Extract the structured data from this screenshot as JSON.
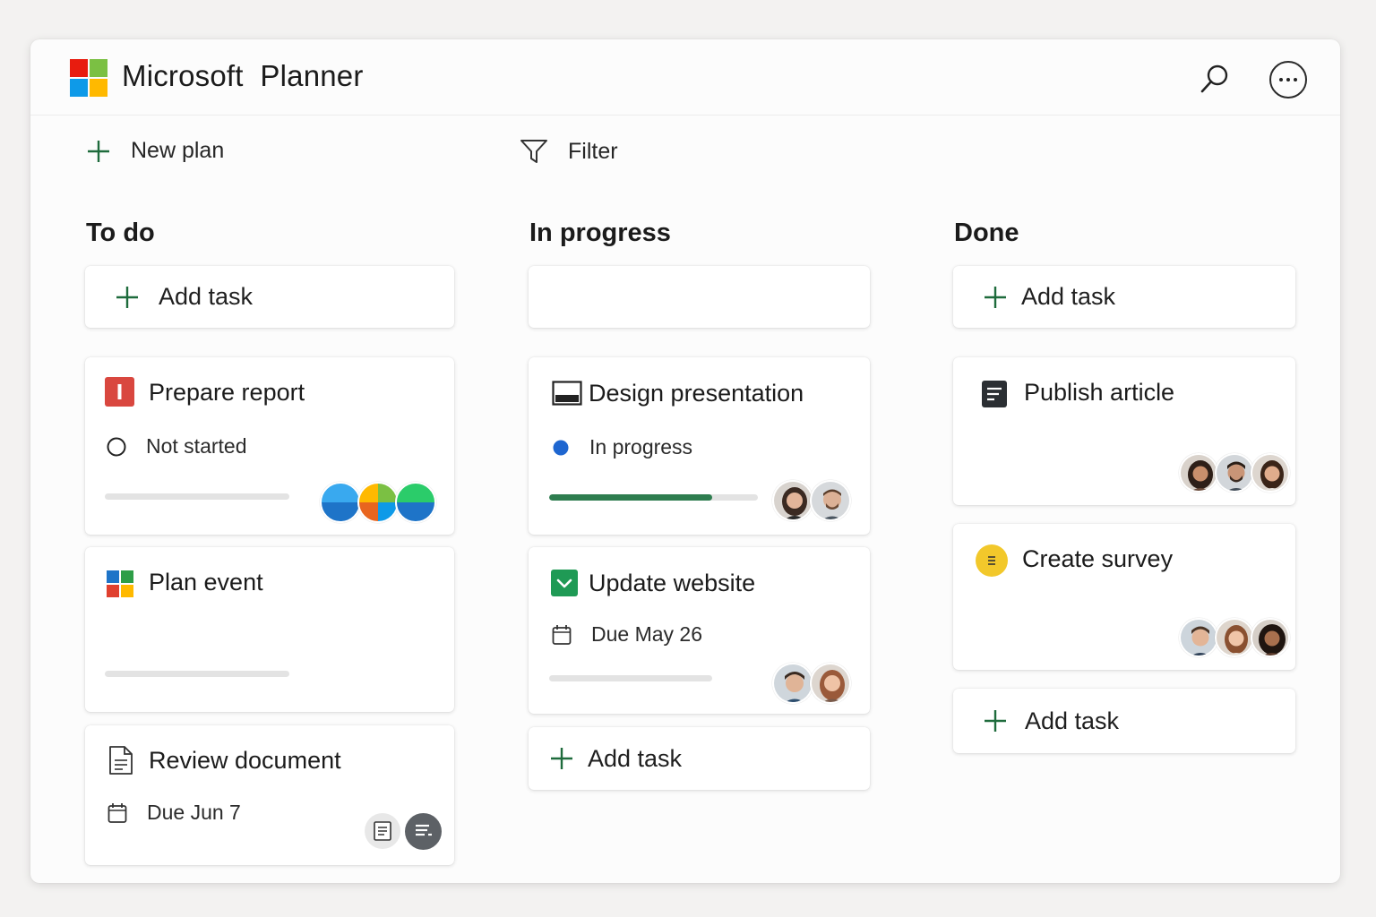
{
  "app": {
    "title_part1": "Microsoft",
    "title_part2": "Planner"
  },
  "brand_colors": [
    "#f25022",
    "#7fba00",
    "#00a4ef",
    "#ffb900"
  ],
  "toolbar": {
    "new_plan": "New plan",
    "filter": "Filter"
  },
  "columns": [
    {
      "title": "To do",
      "add_label": "Add task",
      "tasks": [
        {
          "title": "Prepare report",
          "icon": "priority-icon",
          "status": "Not started",
          "progress": 0
        },
        {
          "title": "Plan event",
          "icon": "apps-grid-icon",
          "progress": 0
        },
        {
          "title": "Review document",
          "icon": "document-icon",
          "due": "Due Jun 7"
        }
      ]
    },
    {
      "title": "In progress",
      "tasks": [
        {
          "title": "Design presentation",
          "icon": "presentation-icon",
          "status": "In progress",
          "progress": 0.78
        },
        {
          "title": "Update website",
          "icon": "checkbox-icon",
          "due": "Due May 26",
          "progress": 0
        }
      ],
      "bottom_add_label": "Add task"
    },
    {
      "title": "Done",
      "add_label": "Add task",
      "tasks": [
        {
          "title": "Publish article",
          "icon": "notes-icon"
        },
        {
          "title": "Create survey",
          "icon": "survey-icon"
        }
      ],
      "bottom_add_label": "Add task"
    }
  ],
  "accent_color": "#2e7d4f",
  "status_dot_color": "#1e66d0"
}
